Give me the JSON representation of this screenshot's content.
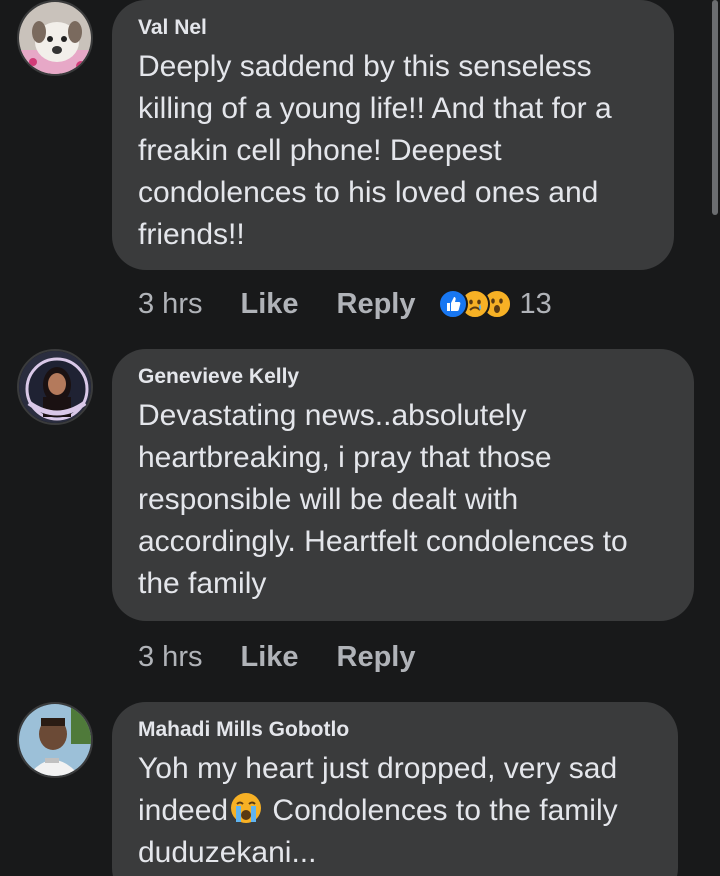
{
  "comments": [
    {
      "author": "Val Nel",
      "lines": [
        "Deeply saddend by this senseless",
        "killing of a young life!! And that for a",
        "freakin cell phone! Deepest",
        "condolences to his loved ones and",
        "friends!!"
      ],
      "time": "3 hrs",
      "like_label": "Like",
      "reply_label": "Reply",
      "reaction_count": "13",
      "reaction_icons": [
        "like-reaction-icon",
        "sad-reaction-icon",
        "wow-reaction-icon"
      ]
    },
    {
      "author": "Genevieve Kelly",
      "lines": [
        "Devastating news..absolutely",
        "heartbreaking, i pray that those",
        "responsible will be dealt with",
        "accordingly. Heartfelt condolences to",
        "the family"
      ],
      "time": "3 hrs",
      "like_label": "Like",
      "reply_label": "Reply"
    },
    {
      "author": "Mahadi Mills Gobotlo",
      "line1": "Yoh my heart just dropped, very sad",
      "line2_before": "indeed",
      "line2_after": " Condolences to the family",
      "line3": "duduzekani...",
      "inline_emoji": "crying-face-emoji"
    }
  ],
  "colors": {
    "background": "#18191a",
    "bubble": "#3a3b3c",
    "text": "#e4e6eb",
    "secondary": "#b0b3b8",
    "like_blue": "#1877f2",
    "reaction_yellow": "#f7b125"
  }
}
